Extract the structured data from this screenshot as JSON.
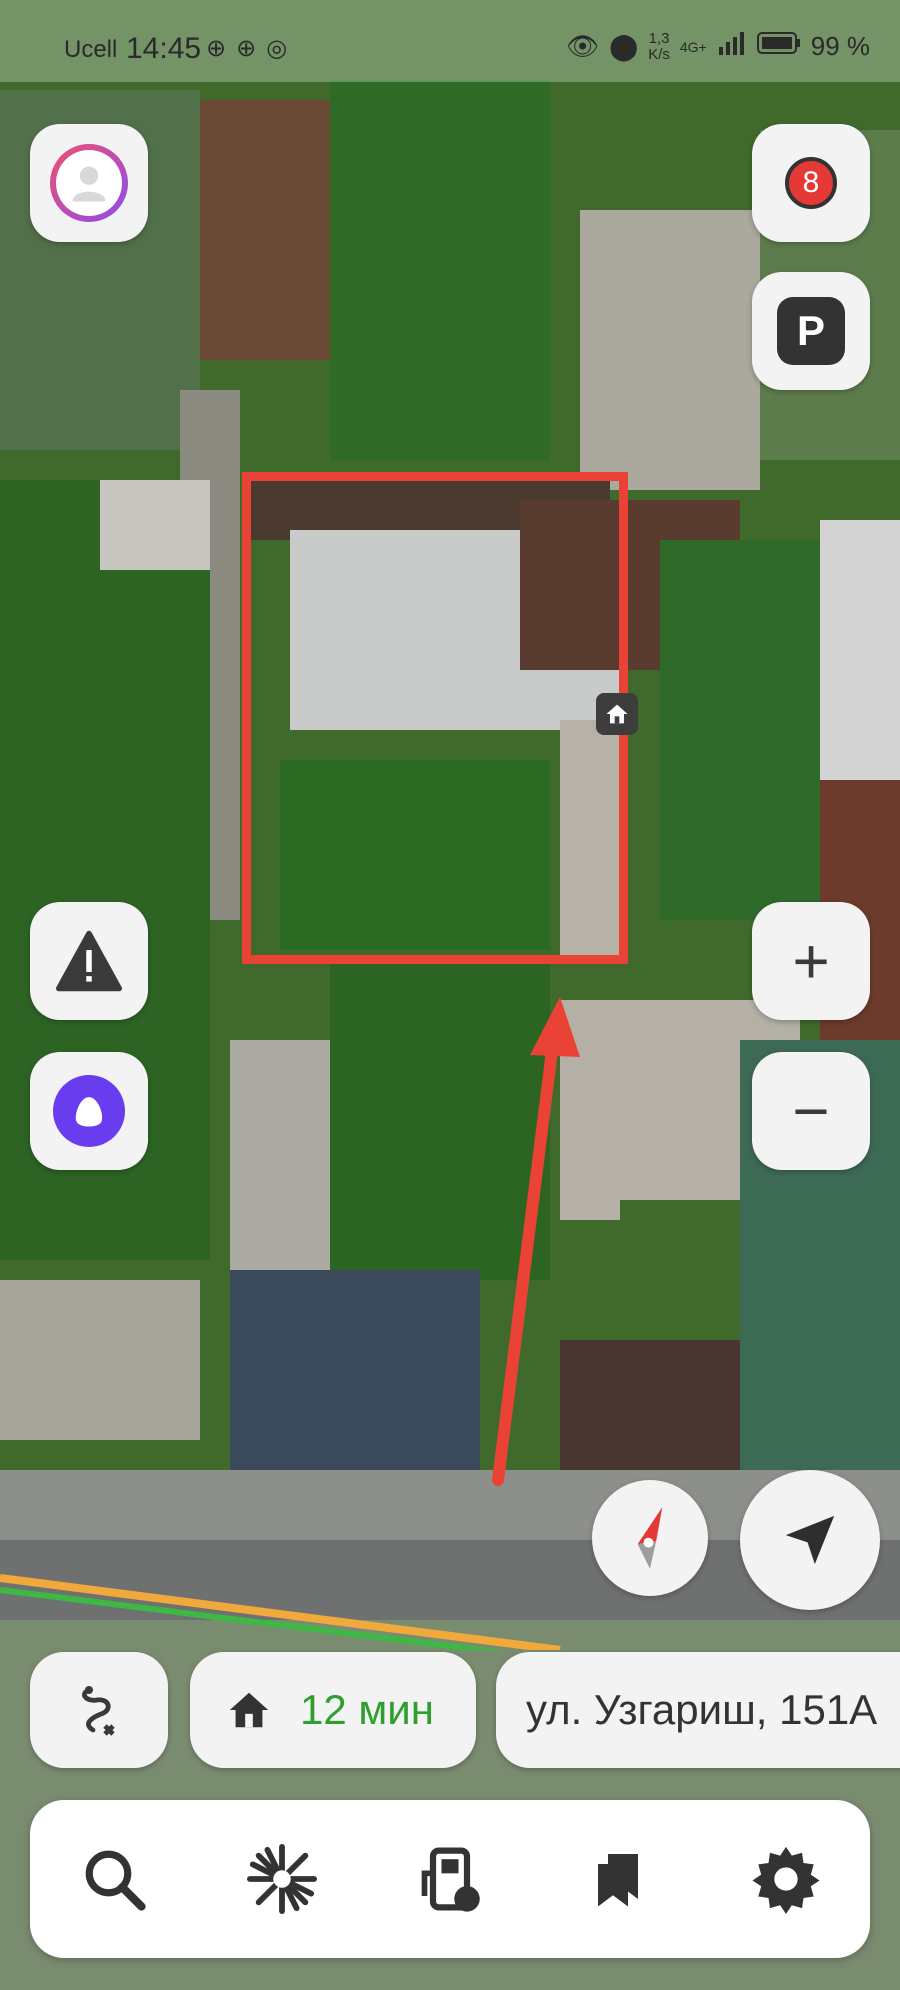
{
  "status_bar": {
    "carrier": "Ucell",
    "time": "14:45",
    "speed_value": "1,3",
    "speed_unit": "K/s",
    "network": "4G+",
    "battery": "99 %",
    "left_icons": [
      "vpn-icon",
      "vpn-icon",
      "instagram-icon"
    ],
    "right_icons": [
      "eye-icon",
      "location-pin-icon",
      "signal-icon",
      "battery-icon"
    ]
  },
  "controls": {
    "notifications_badge": "8",
    "parking_label": "P",
    "zoom_in_label": "+",
    "zoom_out_label": "−"
  },
  "route_panel": {
    "eta": "12 мин",
    "address": "ул. Узгариш, 151А"
  },
  "bottom_nav": {
    "items": [
      "search-icon",
      "discovery-icon",
      "gas-station-icon",
      "bookmarks-icon",
      "settings-icon"
    ]
  },
  "colors": {
    "accent_red": "#ea4335",
    "eta_green": "#2e9e2e",
    "alice_purple": "#6a3cf0",
    "panel_bg": "#f3f3f3"
  }
}
